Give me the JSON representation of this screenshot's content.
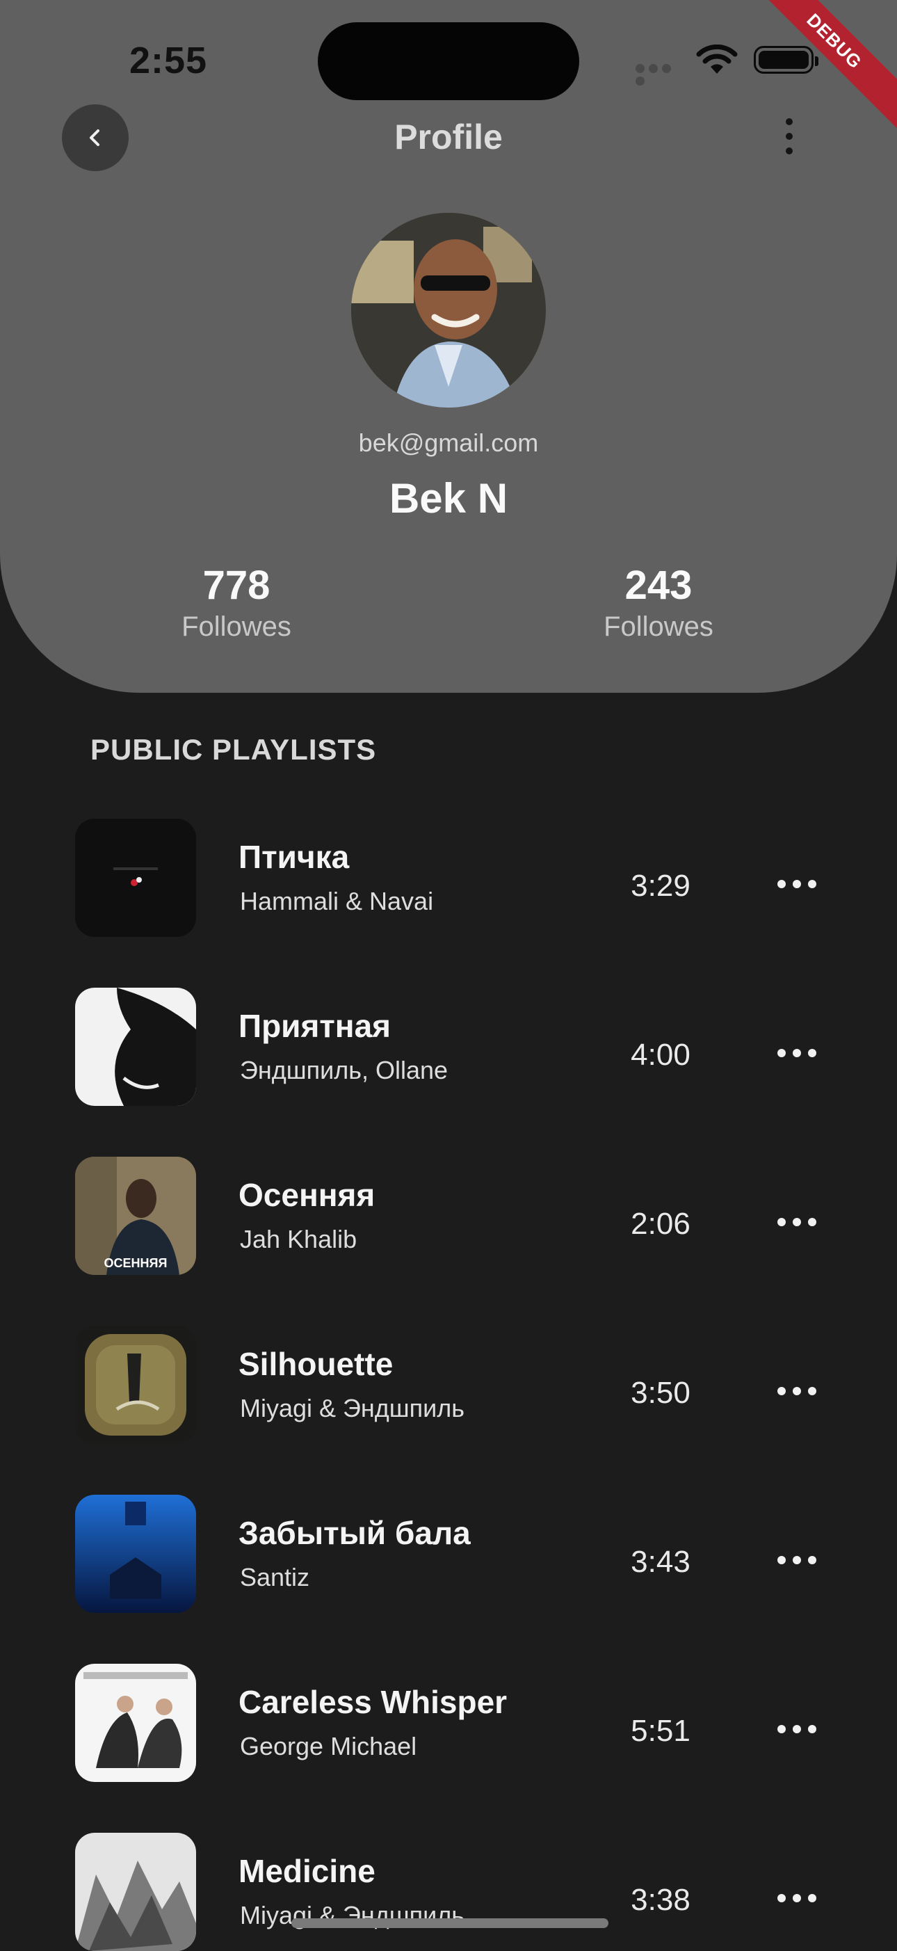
{
  "status_bar": {
    "time": "2:55"
  },
  "debug_banner": "DEBUG",
  "header": {
    "title": "Profile"
  },
  "profile": {
    "email": "bek@gmail.com",
    "name": "Bek N",
    "stats": [
      {
        "value": "778",
        "label": "Followes"
      },
      {
        "value": "243",
        "label": "Followes"
      }
    ]
  },
  "section_title": "PUBLIC PLAYLISTS",
  "tracks": [
    {
      "title": "Птичка",
      "artist": "Hammali & Navai",
      "duration": "3:29"
    },
    {
      "title": "Приятная",
      "artist": "Эндшпиль, Ollane",
      "duration": "4:00"
    },
    {
      "title": "Осенняя",
      "artist": "Jah Khalib",
      "duration": "2:06",
      "cover_text": "ОСЕННЯЯ"
    },
    {
      "title": "Silhouette",
      "artist": "Miyagi & Эндшпиль",
      "duration": "3:50"
    },
    {
      "title": "Забытый бала",
      "artist": "Santiz",
      "duration": "3:43"
    },
    {
      "title": "Careless Whisper",
      "artist": "George Michael",
      "duration": "5:51"
    },
    {
      "title": "Medicine",
      "artist": "Miyagi & Эндшпиль",
      "duration": "3:38"
    }
  ]
}
